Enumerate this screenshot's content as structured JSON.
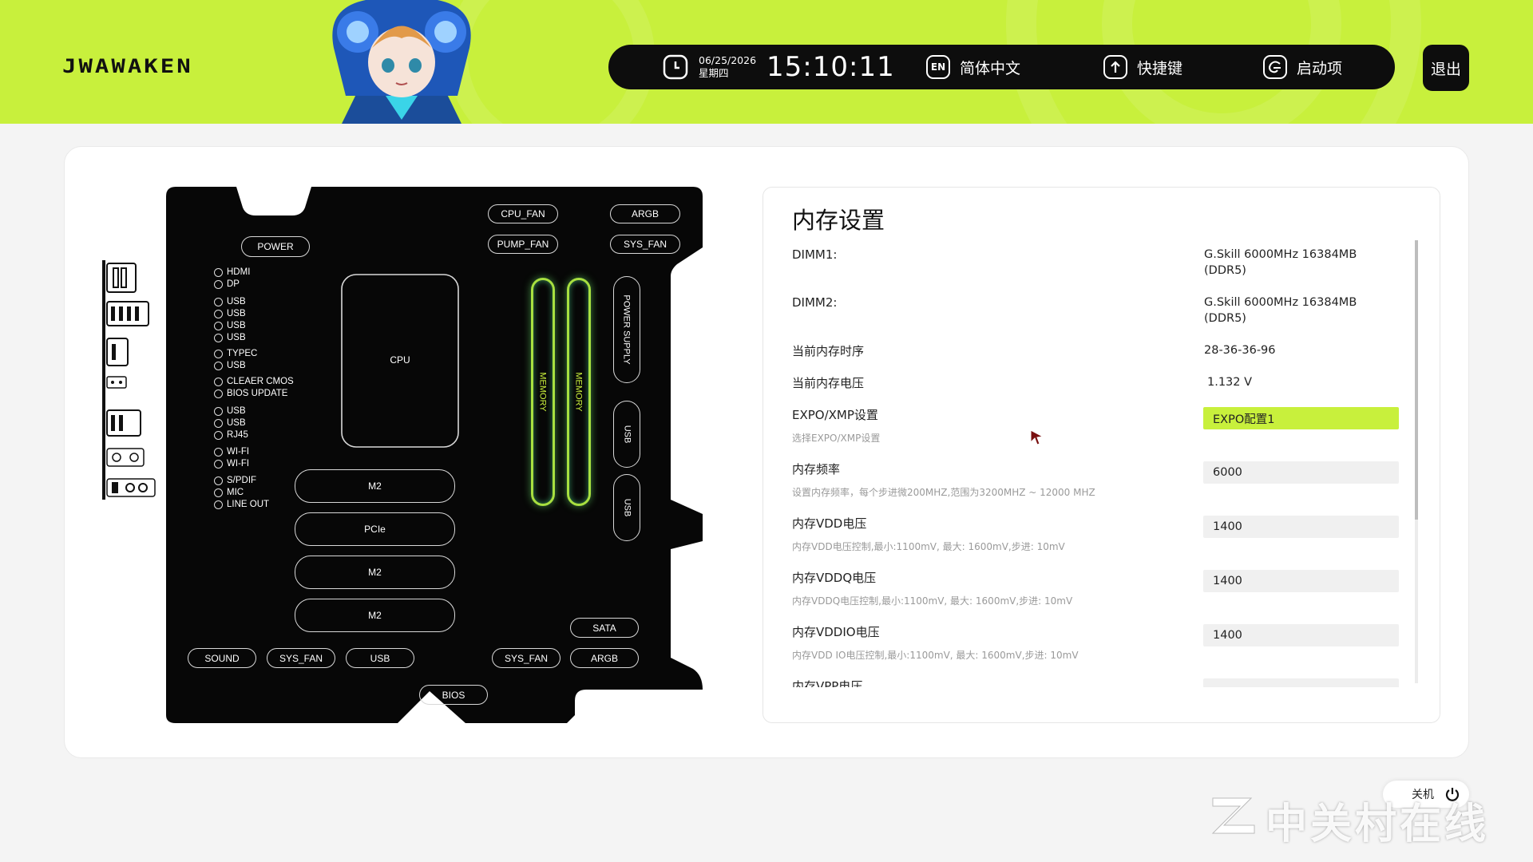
{
  "app": {
    "logo": "JWAWAKEN"
  },
  "topbar": {
    "date": "06/25/2026",
    "weekday": "星期四",
    "time": "15:10:11",
    "lang_icon": "EN",
    "language": "简体中文",
    "shortcut": "快捷键",
    "boot": "启动项",
    "exit": "退出"
  },
  "board": {
    "power": "POWER",
    "cpu_fan": "CPU_FAN",
    "argb_top": "ARGB",
    "pump_fan": "PUMP_FAN",
    "sys_fan_top": "SYS_FAN",
    "cpu": "CPU",
    "memory_1": "MEMORY",
    "memory_2": "MEMORY",
    "power_supply": "POWER SUPPLY",
    "usb_right_1": "USB",
    "usb_right_2": "USB",
    "m2_1": "M2",
    "pcie": "PCIe",
    "m2_2": "M2",
    "m2_3": "M2",
    "sata": "SATA",
    "sound": "SOUND",
    "sys_fan_b1": "SYS_FAN",
    "usb_bottom": "USB",
    "sys_fan_b2": "SYS_FAN",
    "argb_bottom": "ARGB",
    "bios": "BIOS",
    "io_ports": [
      "HDMI",
      "DP",
      "USB",
      "USB",
      "USB",
      "USB",
      "TYPEC",
      "USB",
      "CLEAER CMOS",
      "BIOS UPDATE",
      "USB",
      "USB",
      "RJ45",
      "WI-FI",
      "WI-FI",
      "S/PDIF",
      "MIC",
      "LINE OUT"
    ]
  },
  "memory_panel": {
    "title": "内存设置",
    "dimm1_label": "DIMM1:",
    "dimm1_line1": "G.Skill 6000MHz 16384MB",
    "dimm1_line2": "(DDR5)",
    "dimm2_label": "DIMM2:",
    "dimm2_line1": "G.Skill 6000MHz 16384MB",
    "dimm2_line2": "(DDR5)",
    "timing_label": "当前内存时序",
    "timing_value": "28-36-36-96",
    "voltage_label": "当前内存电压",
    "voltage_value": "1.132 V",
    "expo_label": "EXPO/XMP设置",
    "expo_hint": "选择EXPO/XMP设置",
    "expo_value": "EXPO配置1",
    "freq_label": "内存频率",
    "freq_hint": "设置内存频率，每个步进微200MHZ,范围为3200MHZ ~ 12000 MHZ",
    "freq_value": "6000",
    "vdd_label": "内存VDD电压",
    "vdd_hint": "内存VDD电压控制,最小:1100mV, 最大: 1600mV,步进: 10mV",
    "vdd_value": "1400",
    "vddq_label": "内存VDDQ电压",
    "vddq_hint": "内存VDDQ电压控制,最小:1100mV, 最大: 1600mV,步进: 10mV",
    "vddq_value": "1400",
    "vddio_label": "内存VDDIO电压",
    "vddio_hint": "内存VDD IO电压控制,最小:1100mV, 最大: 1600mV,步进: 10mV",
    "vddio_value": "1400",
    "next_label": "内存VPP电压"
  },
  "footer": {
    "shutdown": "关机",
    "watermark": "中关村在线"
  },
  "colors": {
    "accent": "#c8f03c",
    "dark": "#0d0d0d",
    "memory_glow": "#a8e040"
  }
}
